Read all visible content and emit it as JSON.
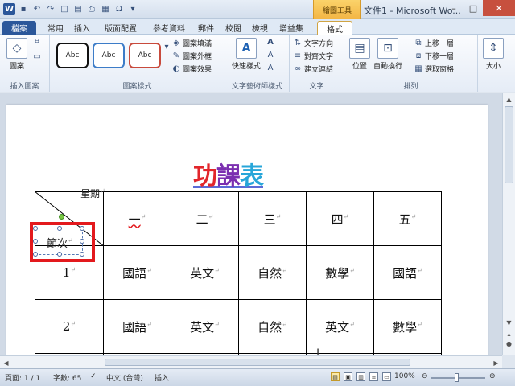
{
  "window": {
    "title": "文件1 - Microsoft Wo...",
    "context_tool": "繪圖工具"
  },
  "tabs": [
    "檔案",
    "常用",
    "插入",
    "版面配置",
    "參考資料",
    "郵件",
    "校閱",
    "檢視",
    "增益集",
    "格式"
  ],
  "ribbon": {
    "insert_shapes": {
      "label": "插入圖案",
      "shapes_btn": "圖案"
    },
    "shape_styles": {
      "label": "圖案樣式",
      "samples": [
        "Abc",
        "Abc",
        "Abc"
      ],
      "fill": "圖案填滿",
      "outline": "圖案外框",
      "effects": "圖案效果"
    },
    "wordart": {
      "label": "文字藝術師樣式",
      "quick_styles": "快速樣式"
    },
    "text": {
      "label": "文字",
      "direction": "文字方向",
      "align": "對齊文字",
      "link": "建立連結"
    },
    "arrange": {
      "label": "排列",
      "position": "位置",
      "wrap": "自動換行",
      "forward": "上移一層",
      "backward": "下移一層",
      "selection_pane": "選取窗格"
    },
    "size": {
      "label": "大小"
    }
  },
  "document": {
    "heading": [
      "功",
      "課",
      "表"
    ],
    "corner_top": "星期",
    "corner_bottom": "節次",
    "days": [
      "一",
      "二",
      "三",
      "四",
      "五"
    ],
    "rows": [
      {
        "period": "1",
        "subjects": [
          "國語",
          "英文",
          "自然",
          "數學",
          "國語"
        ]
      },
      {
        "period": "2",
        "subjects": [
          "國語",
          "英文",
          "自然",
          "英文",
          "數學"
        ]
      }
    ]
  },
  "status": {
    "page": "頁面: 1 / 1",
    "words": "字數: 65",
    "language": "中文 (台灣)",
    "mode": "插入",
    "zoom": "100%"
  }
}
